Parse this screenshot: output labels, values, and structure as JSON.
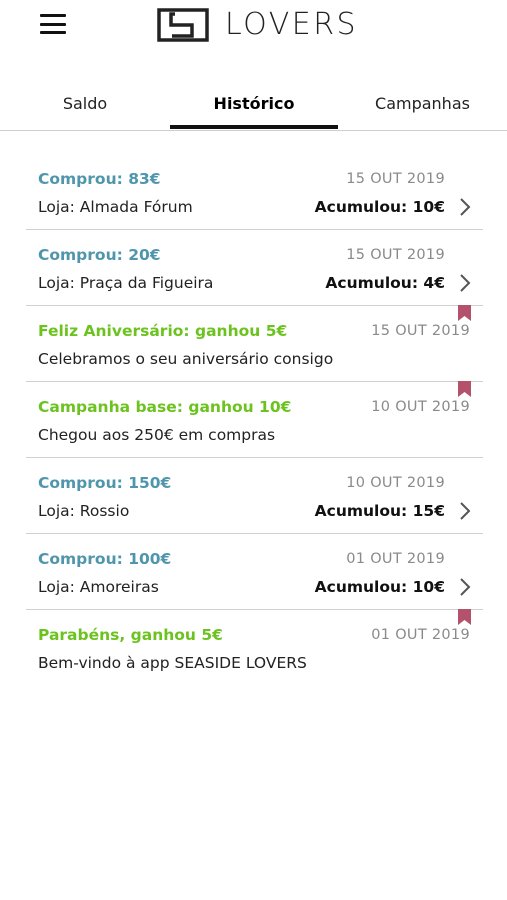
{
  "app": {
    "brand": "LOVERS"
  },
  "tabs": [
    {
      "label": "Saldo"
    },
    {
      "label": "Histórico",
      "active": true
    },
    {
      "label": "Campanhas"
    }
  ],
  "history": [
    {
      "type": "purchase",
      "title": "Comprou:  83€",
      "date": "15 OUT 2019",
      "desc": "Loja: Almada Fórum",
      "accumulated": "Acumulou: 10€"
    },
    {
      "type": "purchase",
      "title": "Comprou:  20€",
      "date": "15 OUT 2019",
      "desc": "Loja: Praça da Figueira",
      "accumulated": "Acumulou: 4€"
    },
    {
      "type": "campaign",
      "title": "Feliz Aniversário: ganhou  5€",
      "date": "15 OUT 2019",
      "desc": "Celebramos o seu aniversário consigo"
    },
    {
      "type": "campaign",
      "title": "Campanha base:  ganhou 10€",
      "date": "10 OUT 2019",
      "desc": "Chegou aos 250€ em compras"
    },
    {
      "type": "purchase",
      "title": "Comprou:  150€",
      "date": "10 OUT 2019",
      "desc": "Loja: Rossio",
      "accumulated": "Acumulou: 15€"
    },
    {
      "type": "purchase",
      "title": "Comprou:  100€",
      "date": "01 OUT 2019",
      "desc": "Loja: Amoreiras",
      "accumulated": "Acumulou: 10€"
    },
    {
      "type": "campaign",
      "title": "Parabéns, ganhou 5€",
      "date": "01 OUT 2019",
      "desc": "Bem-vindo à app SEASIDE LOVERS"
    }
  ],
  "colors": {
    "purchase_title": "#4f96ad",
    "campaign_title": "#6cc31f",
    "bookmark": "#b3526a",
    "date": "#8a8a8a"
  },
  "icons": {
    "menu": "hamburger-icon",
    "row_chevron": "chevron-right-icon",
    "campaign_marker": "bookmark-icon"
  }
}
